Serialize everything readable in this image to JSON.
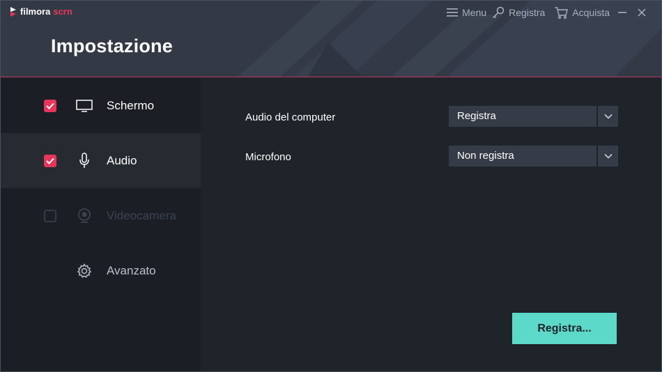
{
  "app": {
    "logo_name": "filmora",
    "logo_suffix": "scrn",
    "logo_mark": "filmora-logo-icon"
  },
  "header": {
    "title": "Impostazione"
  },
  "topnav": {
    "menu_label": "Menu",
    "menu_icon": "hamburger-icon",
    "register_label": "Registra",
    "register_icon": "key-icon",
    "buy_label": "Acquista",
    "buy_icon": "cart-icon",
    "minimize_icon": "minimize-icon",
    "close_icon": "close-icon"
  },
  "sidebar": {
    "items": [
      {
        "label": "Schermo",
        "icon": "monitor-icon",
        "checked": true,
        "enabled": true
      },
      {
        "label": "Audio",
        "icon": "microphone-icon",
        "checked": true,
        "enabled": true,
        "selected": true
      },
      {
        "label": "Videocamera",
        "icon": "webcam-icon",
        "checked": false,
        "enabled": false
      },
      {
        "label": "Avanzato",
        "icon": "gear-icon"
      }
    ]
  },
  "main": {
    "rows": [
      {
        "label": "Audio del computer",
        "value": "Registra"
      },
      {
        "label": "Microfono",
        "value": "Non registra"
      }
    ],
    "record_button": "Registra..."
  },
  "colors": {
    "accent": "#e8355c",
    "button": "#5cd9c9",
    "header_bg": "#333a46",
    "sidebar_bg": "#1b1e24",
    "main_bg": "#1f232a"
  }
}
